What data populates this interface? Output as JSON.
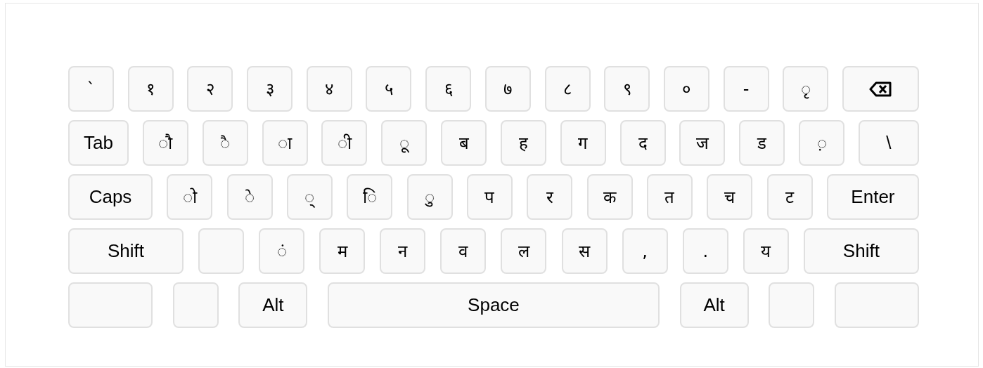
{
  "keyboard": {
    "rows": [
      {
        "keys": [
          {
            "kind": "char",
            "label": "`"
          },
          {
            "kind": "char",
            "label": "१"
          },
          {
            "kind": "char",
            "label": "२"
          },
          {
            "kind": "char",
            "label": "३"
          },
          {
            "kind": "char",
            "label": "४"
          },
          {
            "kind": "char",
            "label": "५"
          },
          {
            "kind": "char",
            "label": "६"
          },
          {
            "kind": "char",
            "label": "७"
          },
          {
            "kind": "char",
            "label": "८"
          },
          {
            "kind": "char",
            "label": "९"
          },
          {
            "kind": "char",
            "label": "०"
          },
          {
            "kind": "char",
            "label": "-"
          },
          {
            "kind": "char",
            "label": "◌ृ"
          },
          {
            "kind": "backspace"
          }
        ]
      },
      {
        "keys": [
          {
            "kind": "tab",
            "label": "Tab"
          },
          {
            "kind": "char",
            "label": "◌ौ"
          },
          {
            "kind": "char",
            "label": "◌ै"
          },
          {
            "kind": "char",
            "label": "◌ा"
          },
          {
            "kind": "char",
            "label": "◌ी"
          },
          {
            "kind": "char",
            "label": "◌ू"
          },
          {
            "kind": "char",
            "label": "ब"
          },
          {
            "kind": "char",
            "label": "ह"
          },
          {
            "kind": "char",
            "label": "ग"
          },
          {
            "kind": "char",
            "label": "द"
          },
          {
            "kind": "char",
            "label": "ज"
          },
          {
            "kind": "char",
            "label": "ड"
          },
          {
            "kind": "char",
            "label": "◌़"
          },
          {
            "kind": "tab",
            "label": "\\"
          }
        ]
      },
      {
        "keys": [
          {
            "kind": "caps",
            "label": "Caps"
          },
          {
            "kind": "char",
            "label": "◌ो"
          },
          {
            "kind": "char",
            "label": "◌े"
          },
          {
            "kind": "char",
            "label": "◌्"
          },
          {
            "kind": "char",
            "label": "◌ि"
          },
          {
            "kind": "char",
            "label": "◌ु"
          },
          {
            "kind": "char",
            "label": "प"
          },
          {
            "kind": "char",
            "label": "र"
          },
          {
            "kind": "char",
            "label": "क"
          },
          {
            "kind": "char",
            "label": "त"
          },
          {
            "kind": "char",
            "label": "च"
          },
          {
            "kind": "char",
            "label": "ट"
          },
          {
            "kind": "enter",
            "label": "Enter"
          }
        ]
      },
      {
        "keys": [
          {
            "kind": "shift",
            "label": "Shift"
          },
          {
            "kind": "blank"
          },
          {
            "kind": "char",
            "label": "◌ं"
          },
          {
            "kind": "char",
            "label": "म"
          },
          {
            "kind": "char",
            "label": "न"
          },
          {
            "kind": "char",
            "label": "व"
          },
          {
            "kind": "char",
            "label": "ल"
          },
          {
            "kind": "char",
            "label": "स"
          },
          {
            "kind": "char",
            "label": ","
          },
          {
            "kind": "char",
            "label": "."
          },
          {
            "kind": "char",
            "label": "य"
          },
          {
            "kind": "shift",
            "label": "Shift"
          }
        ]
      },
      {
        "keys": [
          {
            "kind": "blank-wide"
          },
          {
            "kind": "blank"
          },
          {
            "kind": "alt",
            "label": "Alt"
          },
          {
            "kind": "space",
            "label": "Space"
          },
          {
            "kind": "alt",
            "label": "Alt"
          },
          {
            "kind": "blank"
          },
          {
            "kind": "blank-wide"
          }
        ]
      }
    ]
  }
}
